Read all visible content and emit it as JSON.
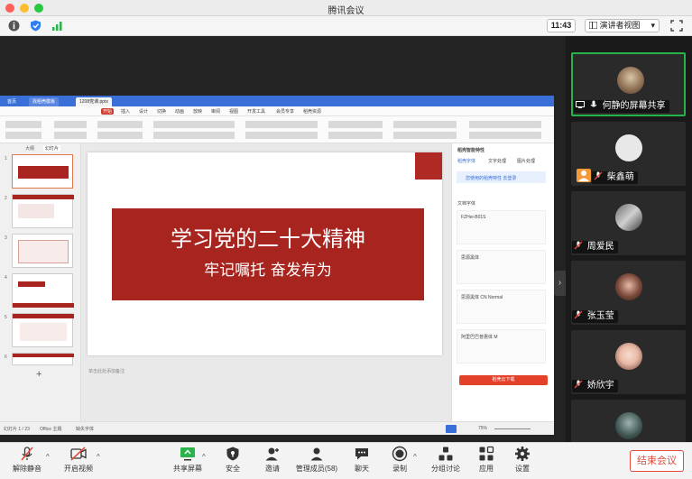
{
  "window": {
    "title": "腾讯会议"
  },
  "topbar": {
    "time": "11:43",
    "view_label": "演讲者视图",
    "view_caret": "▾"
  },
  "shared_app": {
    "tabs": [
      "首页",
      "找稻壳模板",
      "1208党课.pptx"
    ],
    "menu": [
      "开始",
      "插入",
      "设计",
      "切换",
      "动画",
      "放映",
      "审阅",
      "视图",
      "开发工具",
      "会员专享",
      "稻壳资源"
    ],
    "slide": {
      "title": "学习党的二十大精神",
      "subtitle": "牢记嘱托  奋发有为"
    },
    "thumb_numbers": [
      "1",
      "2",
      "3",
      "4",
      "5",
      "6"
    ],
    "thumb_tabs": [
      "大纲",
      "幻灯片"
    ],
    "notes": "单击此处添加备注",
    "font_pane": {
      "header": "稻壳智能特性",
      "tabs": [
        "稻壳字体",
        "文字处理",
        "图片处理"
      ],
      "notice": "您使用的稻壳特性 去登录",
      "section": "文档字体",
      "fonts": [
        "FZHei-B01S",
        "思源黑体",
        "思源黑体 CN Normal",
        "阿里巴巴普惠体 M"
      ],
      "download_label": "稻壳云下载"
    },
    "status": {
      "slide_pos": "幻灯片 1 / 23",
      "theme": "Office 主题",
      "missing_font": "缺失字体",
      "zoom": "75%"
    }
  },
  "participants": [
    {
      "name": "何静的屏幕共享",
      "active": true
    },
    {
      "name": "柴鑫萌",
      "active": false
    },
    {
      "name": "周爱民",
      "active": false
    },
    {
      "name": "张玉莹",
      "active": false
    },
    {
      "name": "娇欣宇",
      "active": false
    },
    {
      "name": "",
      "active": false
    }
  ],
  "toolbar": {
    "unmute": "解除静音",
    "start_video": "开启视频",
    "share_screen": "共享屏幕",
    "security": "安全",
    "invite": "邀请",
    "manage_members": "管理成员(58)",
    "chat": "聊天",
    "record": "录制",
    "breakout": "分组讨论",
    "apps": "应用",
    "settings": "设置",
    "end_meeting": "结束会议",
    "caret": "^"
  },
  "colors": {
    "slide_red": "#a8251f",
    "active_border": "#27b24a",
    "end_red": "#e34a3c"
  }
}
